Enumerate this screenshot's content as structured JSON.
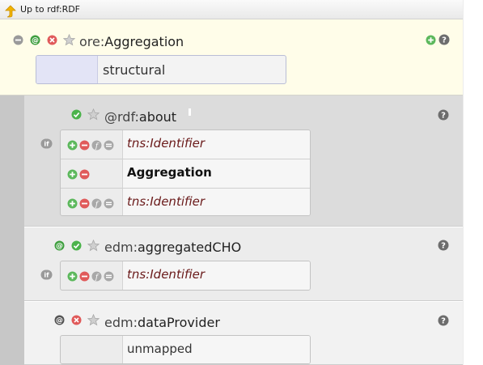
{
  "nav": {
    "up_label": "Up to rdf:RDF"
  },
  "colors": {
    "add_green": "#5cb85c",
    "remove_red": "#e05a5a",
    "check_green": "#4bb34b",
    "at_green": "#3f9f3f",
    "star_gray": "#b8b8b8",
    "help_gray": "#6d6d6d",
    "root_bg": "#fffde9",
    "type_text": "#6a1a1a"
  },
  "root": {
    "prefix": "ore:",
    "name": "Aggregation",
    "value": "structural",
    "icons": [
      "collapse-icon",
      "at-icon",
      "remove-icon",
      "star-icon"
    ],
    "right_icons": [
      "add-icon",
      "help-icon"
    ]
  },
  "children": [
    {
      "prefix": "@rdf:",
      "name": "about",
      "icons": [
        "check-icon",
        "star-icon"
      ],
      "marker": "if",
      "rows": [
        {
          "controls": [
            "add-icon",
            "remove-icon",
            "function-icon",
            "option-icon"
          ],
          "text": "tns:Identifier",
          "style": "type"
        },
        {
          "controls": [
            "add-icon",
            "remove-icon"
          ],
          "text": "Aggregation",
          "style": "bold"
        },
        {
          "controls": [
            "add-icon",
            "remove-icon",
            "function-icon",
            "option-icon"
          ],
          "text": "tns:Identifier",
          "style": "type"
        }
      ]
    },
    {
      "prefix": "edm:",
      "name": "aggregatedCHO",
      "icons": [
        "at-icon",
        "check-icon",
        "star-icon"
      ],
      "marker": "if",
      "rows": [
        {
          "controls": [
            "add-icon",
            "remove-icon",
            "function-icon",
            "option-icon"
          ],
          "text": "tns:Identifier",
          "style": "type"
        }
      ]
    },
    {
      "prefix": "edm:",
      "name": "dataProvider",
      "icons": [
        "at-icon",
        "remove-icon",
        "star-icon"
      ],
      "rows": [
        {
          "controls": [],
          "text": "unmapped",
          "style": "plain"
        }
      ]
    }
  ]
}
